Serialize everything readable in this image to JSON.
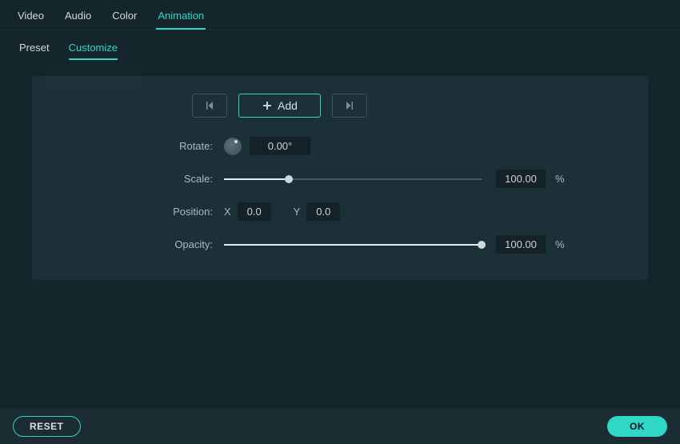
{
  "top_tabs": {
    "video": "Video",
    "audio": "Audio",
    "color": "Color",
    "animation": "Animation"
  },
  "sub_tabs": {
    "preset": "Preset",
    "customize": "Customize"
  },
  "toolbar": {
    "add_label": "Add"
  },
  "rows": {
    "rotate": {
      "label": "Rotate:",
      "value": "0.00°"
    },
    "scale": {
      "label": "Scale:",
      "value": "100.00",
      "unit": "%",
      "percent": 25
    },
    "position": {
      "label": "Position:",
      "x_label": "X",
      "x_value": "0.0",
      "y_label": "Y",
      "y_value": "0.0"
    },
    "opacity": {
      "label": "Opacity:",
      "value": "100.00",
      "unit": "%",
      "percent": 100
    }
  },
  "footer": {
    "reset": "RESET",
    "ok": "OK"
  }
}
